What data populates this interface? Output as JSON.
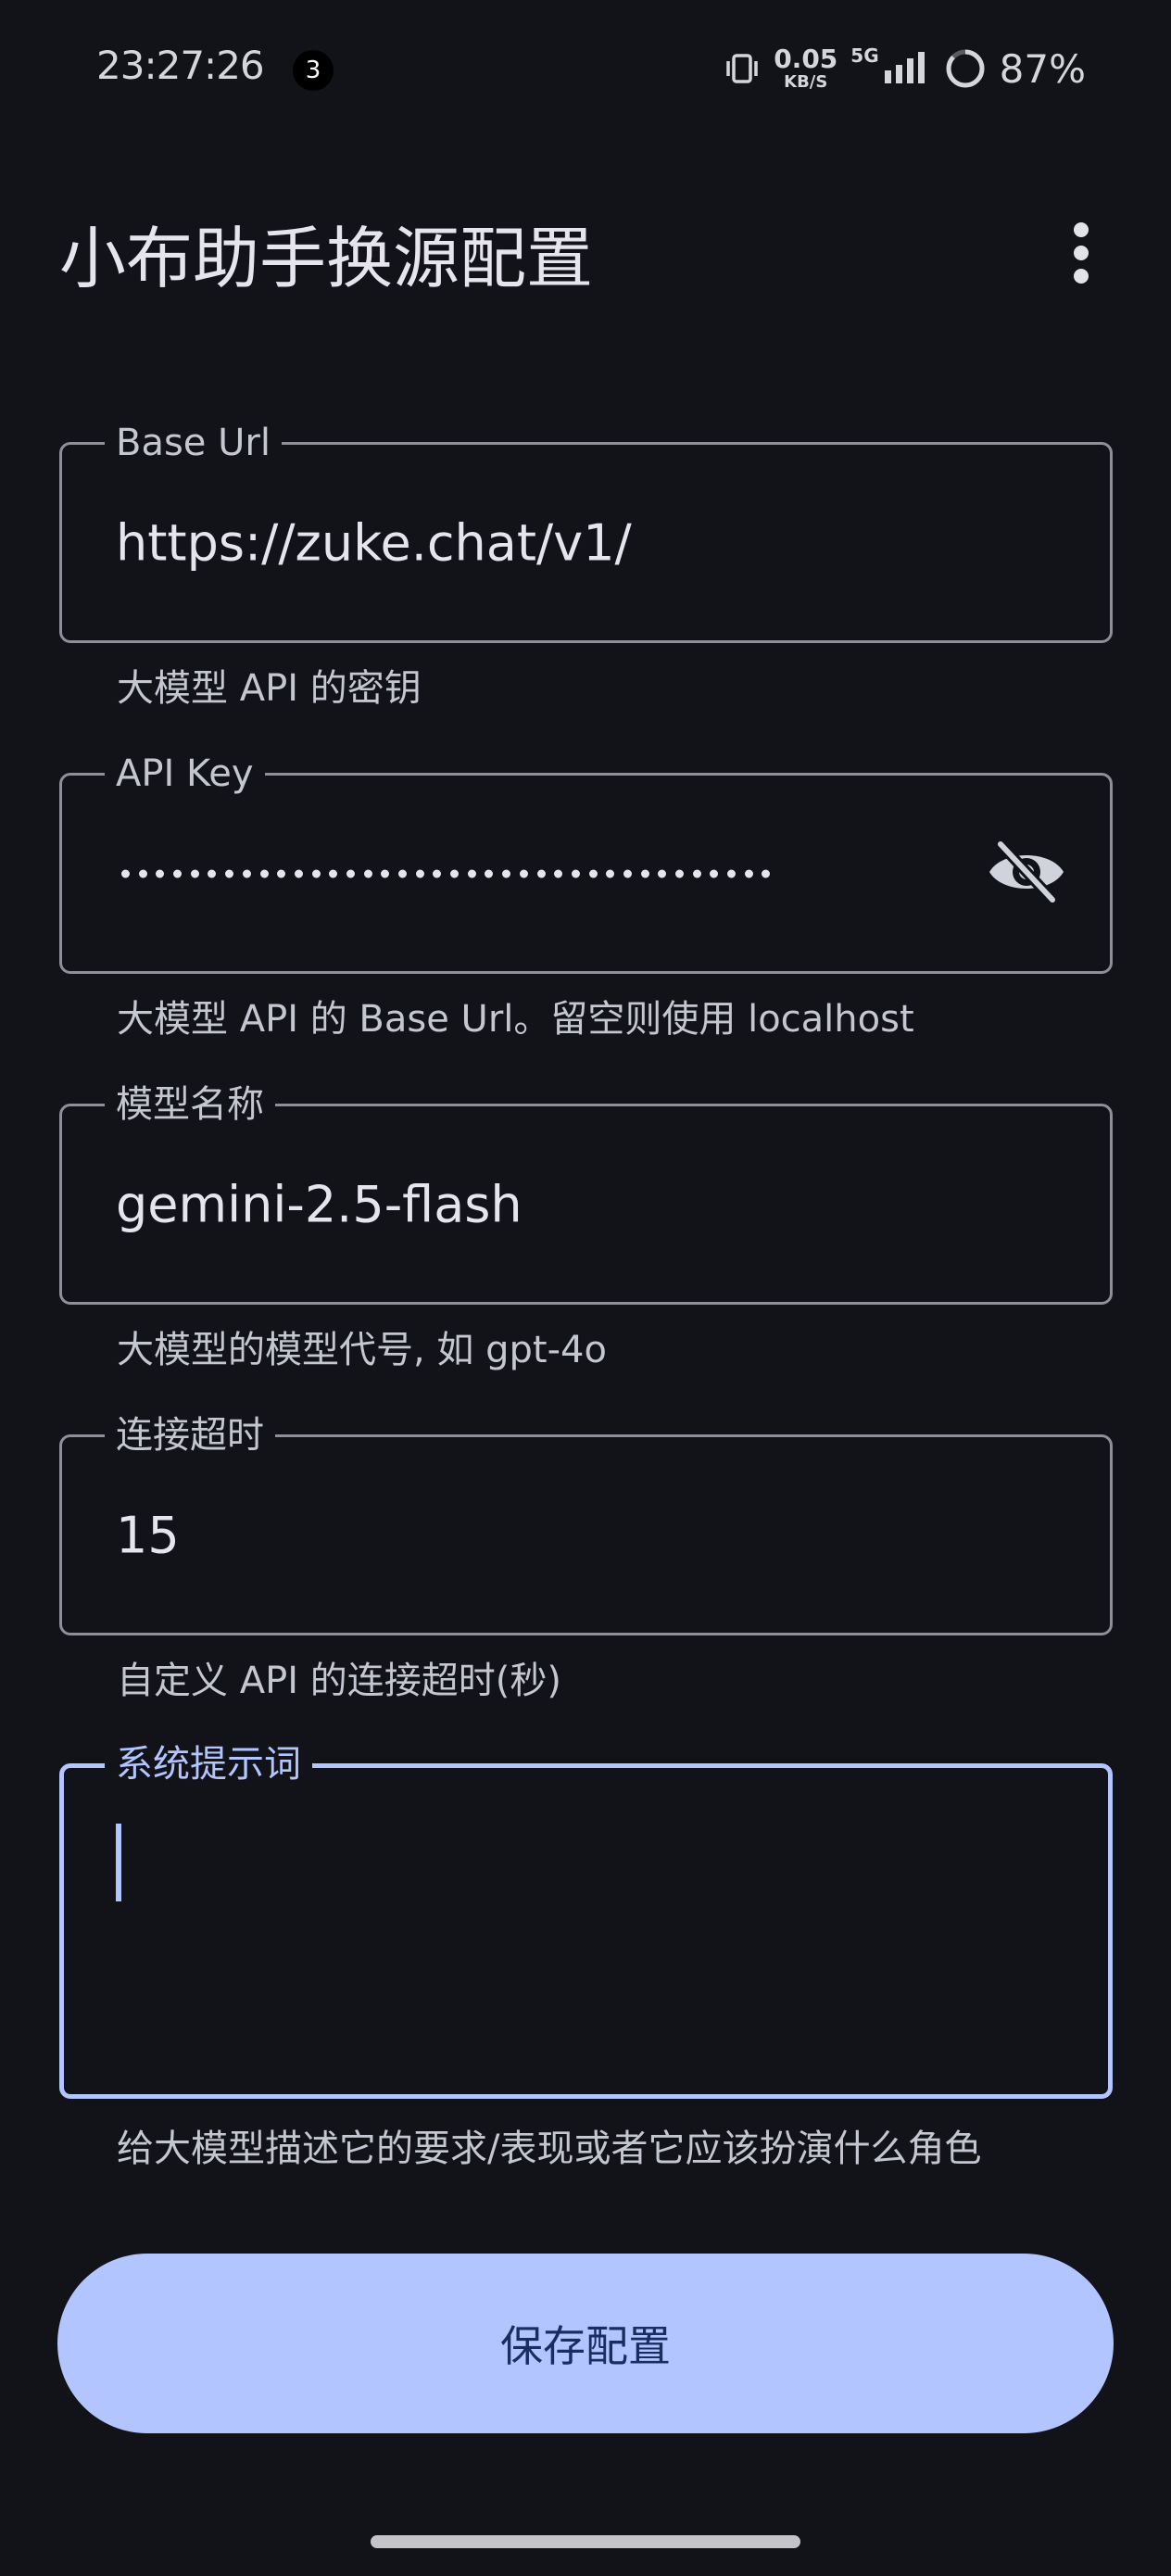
{
  "status_bar": {
    "time": "23:27:26",
    "notification_count": "3",
    "net_speed": "0.05",
    "net_speed_unit": "KB/S",
    "network_type": "5G",
    "battery": "87%"
  },
  "app_bar": {
    "title": "小布助手换源配置",
    "more_icon": "more-vert-icon"
  },
  "form": {
    "base_url": {
      "label": "Base Url",
      "value": "https://zuke.chat/v1/",
      "helper": "大模型 API 的密钥"
    },
    "api_key": {
      "label": "API Key",
      "masked": true,
      "visibility_icon": "visibility-off-icon",
      "helper": "大模型 API 的 Base Url。留空则使用 localhost"
    },
    "model_name": {
      "label": "模型名称",
      "value": "gemini-2.5-flash",
      "helper": "大模型的模型代号, 如 gpt-4o"
    },
    "timeout": {
      "label": "连接超时",
      "value": "15",
      "helper": "自定义 API 的连接超时(秒)"
    },
    "system_prompt": {
      "label": "系统提示词",
      "value": "",
      "focused": true,
      "helper": "给大模型描述它的要求/表现或者它应该扮演什么角色"
    }
  },
  "save_button": {
    "label": "保存配置"
  },
  "colors": {
    "background": "#121319",
    "accent": "#b3c5ff",
    "outline": "#8d8f99",
    "on_accent": "#1a2d60"
  }
}
